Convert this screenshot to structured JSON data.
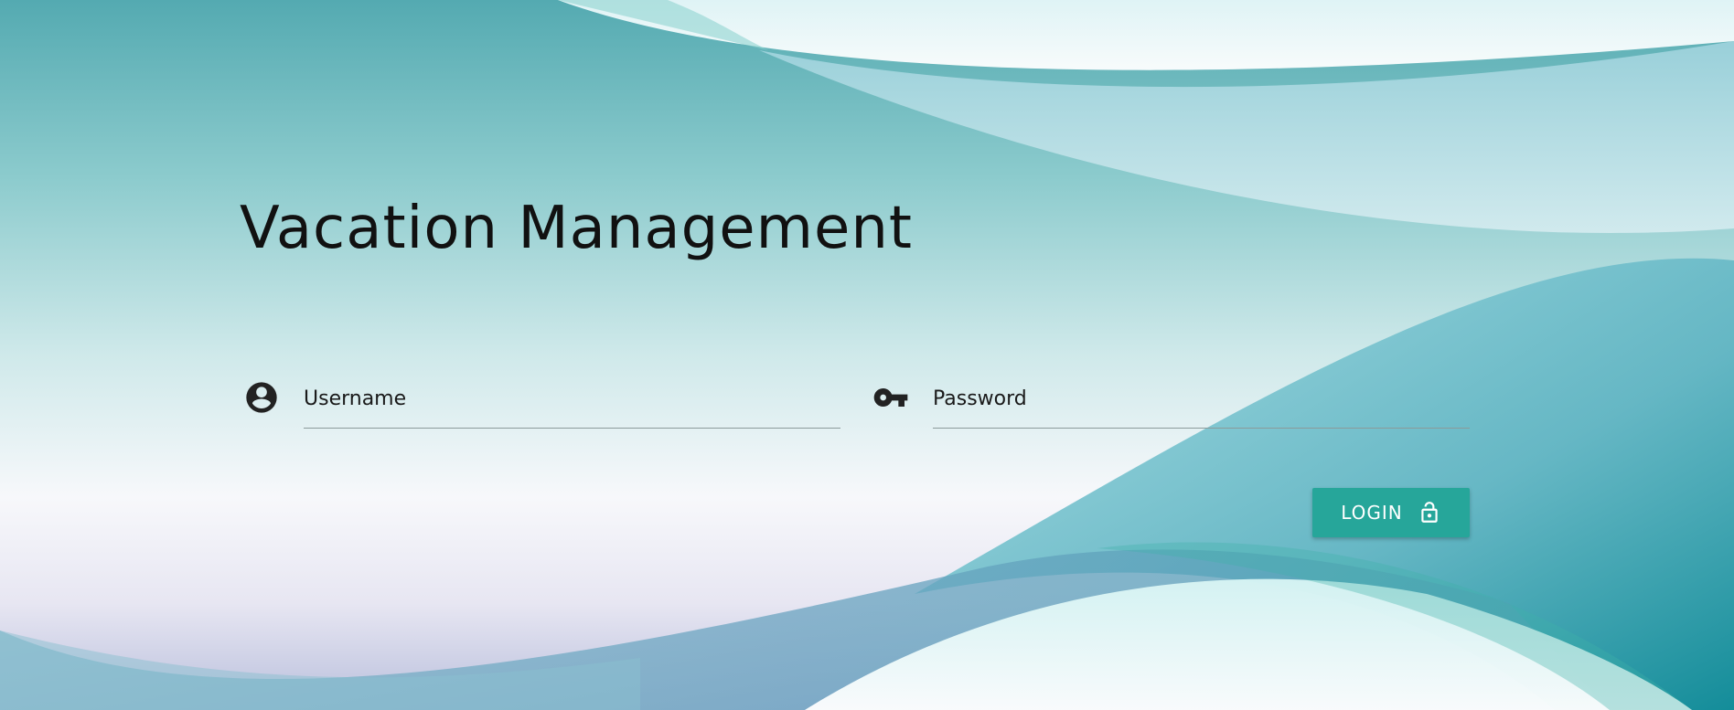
{
  "page": {
    "title": "Vacation Management"
  },
  "form": {
    "username": {
      "placeholder": "Username",
      "value": "",
      "icon": "account-circle-icon"
    },
    "password": {
      "placeholder": "Password",
      "value": "",
      "icon": "key-icon"
    },
    "login": {
      "label": "LOGIN",
      "icon": "lock-open-icon"
    }
  },
  "colors": {
    "accent": "#26a69a",
    "teal_dark": "#0b8a96",
    "teal_light": "#9fd7dc",
    "text": "#111111"
  }
}
